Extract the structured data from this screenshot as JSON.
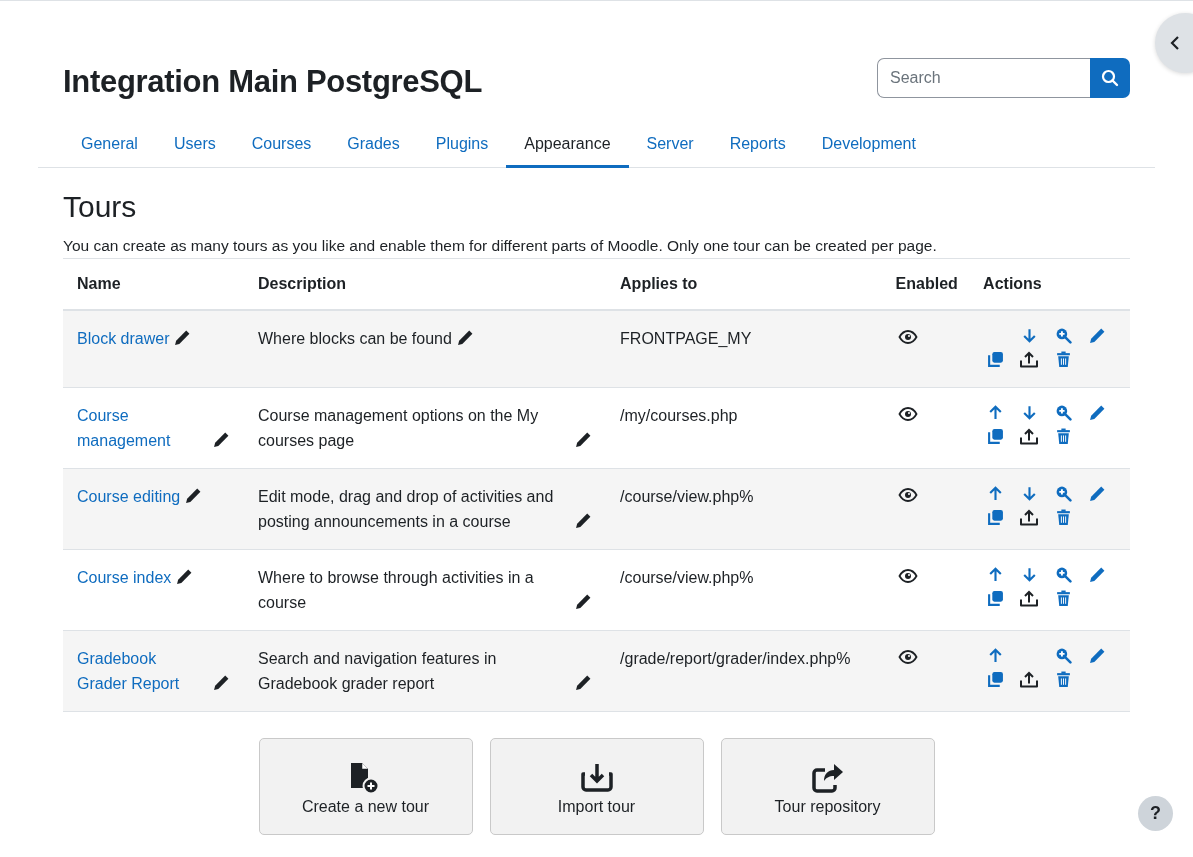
{
  "site_title": "Integration Main PostgreSQL",
  "search": {
    "placeholder": "Search"
  },
  "tabs": [
    {
      "label": "General",
      "selected": false
    },
    {
      "label": "Users",
      "selected": false
    },
    {
      "label": "Courses",
      "selected": false
    },
    {
      "label": "Grades",
      "selected": false
    },
    {
      "label": "Plugins",
      "selected": false
    },
    {
      "label": "Appearance",
      "selected": true
    },
    {
      "label": "Server",
      "selected": false
    },
    {
      "label": "Reports",
      "selected": false
    },
    {
      "label": "Development",
      "selected": false
    }
  ],
  "heading": "Tours",
  "intro": "You can create as many tours as you like and enable them for different parts of Moodle. Only one tour can be created per page.",
  "table": {
    "columns": [
      "Name",
      "Description",
      "Applies to",
      "Enabled",
      "Actions"
    ],
    "rows": [
      {
        "name": "Block drawer",
        "description": "Where blocks can be found",
        "applies_to": "FRONTPAGE_MY",
        "enabled": true,
        "can_move_up": false,
        "can_move_down": true
      },
      {
        "name": "Course management",
        "description": "Course management options on the My courses page",
        "applies_to": "/my/courses.php",
        "enabled": true,
        "can_move_up": true,
        "can_move_down": true
      },
      {
        "name": "Course editing",
        "description": "Edit mode, drag and drop of activities and posting announcements in a course",
        "applies_to": "/course/view.php%",
        "enabled": true,
        "can_move_up": true,
        "can_move_down": true
      },
      {
        "name": "Course index",
        "description": "Where to browse through activities in a course",
        "applies_to": "/course/view.php%",
        "enabled": true,
        "can_move_up": true,
        "can_move_down": true
      },
      {
        "name": "Gradebook Grader Report",
        "description": "Search and navigation features in Gradebook grader report",
        "applies_to": "/grade/report/grader/index.php%",
        "enabled": true,
        "can_move_up": true,
        "can_move_down": false
      }
    ]
  },
  "buttons": [
    {
      "label": "Create a new tour",
      "kind": "create"
    },
    {
      "label": "Import tour",
      "kind": "import"
    },
    {
      "label": "Tour repository",
      "kind": "repository"
    }
  ],
  "help_button": "?"
}
